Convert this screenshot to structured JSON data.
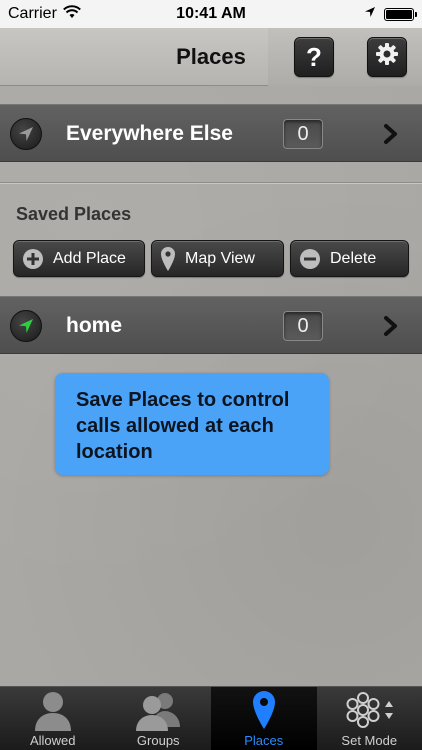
{
  "status_bar": {
    "carrier": "Carrier",
    "time": "10:41 AM"
  },
  "nav": {
    "title": "Places",
    "help_label": "?"
  },
  "everywhere_row": {
    "label": "Everywhere Else",
    "count": "0"
  },
  "saved_places": {
    "title": "Saved Places",
    "add_label": "Add Place",
    "map_label": "Map View",
    "delete_label": "Delete"
  },
  "places": [
    {
      "label": "home",
      "count": "0"
    }
  ],
  "callout": {
    "text": "Save Places to control calls allowed at each location"
  },
  "tabs": [
    {
      "label": "Allowed",
      "icon": "person-icon"
    },
    {
      "label": "Groups",
      "icon": "group-icon"
    },
    {
      "label": "Places",
      "icon": "map-pin-icon"
    },
    {
      "label": "Set Mode",
      "icon": "hexagon-mode-icon"
    }
  ],
  "colors": {
    "accent_blue": "#2a8cff",
    "callout_bg": "#4aa3f7",
    "location_green": "#2ecc40"
  }
}
